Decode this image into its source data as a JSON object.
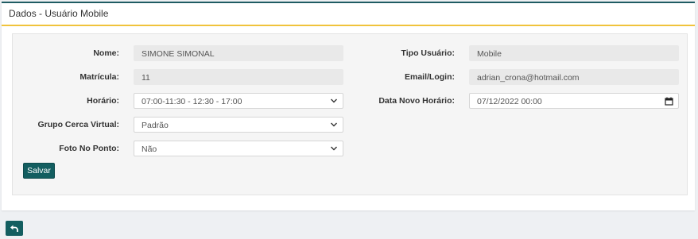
{
  "panel": {
    "title": "Dados - Usuário Mobile"
  },
  "form": {
    "nome": {
      "label": "Nome:",
      "value": "SIMONE SIMONAL"
    },
    "tipo_usuario": {
      "label": "Tipo Usuário:",
      "value": "Mobile"
    },
    "matricula": {
      "label": "Matrícula:",
      "value": "11"
    },
    "email_login": {
      "label": "Email/Login:",
      "value": "adrian_crona@hotmail.com"
    },
    "horario": {
      "label": "Horário:",
      "value": "07:00-11:30 - 12:30 - 17:00"
    },
    "data_novo_horario": {
      "label": "Data Novo Horário:",
      "value": "07/12/2022 00:00"
    },
    "grupo_cerca_virtual": {
      "label": "Grupo Cerca Virtual:",
      "value": "Padrão"
    },
    "foto_no_ponto": {
      "label": "Foto No Ponto:",
      "value": "Não"
    }
  },
  "buttons": {
    "save_label": "Salvar",
    "back_icon": "undo-arrow-icon"
  },
  "colors": {
    "header_top_border": "#1f5c63",
    "header_underline": "#f0c33c",
    "button_primary": "#135e60"
  }
}
